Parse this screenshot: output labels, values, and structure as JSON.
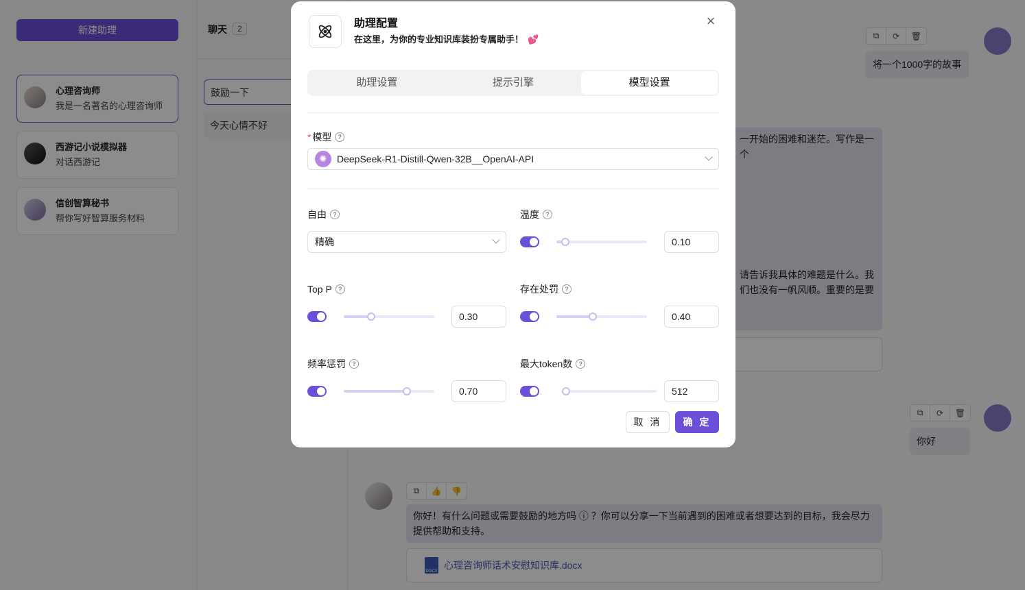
{
  "sidebar": {
    "new_button": "新建助理",
    "assistants": [
      {
        "title": "心理咨询师",
        "desc": "我是一名著名的心理咨询师"
      },
      {
        "title": "西游记小说模拟器",
        "desc": "对话西游记"
      },
      {
        "title": "信创智算秘书",
        "desc": "帮你写好智算服务材料"
      }
    ]
  },
  "topics": {
    "header": "聊天",
    "count": "2",
    "items": [
      "鼓励一下",
      "今天心情不好"
    ]
  },
  "chat": {
    "user_msg_1": "将一个1000字的故事",
    "ai_msg_1_line1": "一开始的困难和迷茫。写作是一个",
    "ai_msg_1_line2": "请告诉我具体的难题是什么。我",
    "ai_msg_1_line3": "们也没有一帆风顺。重要的是要",
    "user_msg_2": "你好",
    "ai_msg_2": "你好！有什么问题或需要鼓励的地方吗 ⓘ ？你可以分享一下当前遇到的困难或者想要达到的目标，我会尽力提供帮助和支持。",
    "file_name": "心理咨询师话术安慰知识库.docx",
    "file_badge": "DOCX"
  },
  "modal": {
    "title": "助理配置",
    "subtitle": "在这里，为你的专业知识库装扮专属助手！",
    "heart": "💕",
    "close": "×",
    "tabs": [
      "助理设置",
      "提示引擎",
      "模型设置"
    ],
    "model_label": "模型",
    "model_value": "DeepSeek-R1-Distill-Qwen-32B__OpenAI-API",
    "freedom_label": "自由",
    "freedom_value": "精确",
    "temperature_label": "温度",
    "temperature_value": "0.10",
    "top_p_label": "Top P",
    "top_p_value": "0.30",
    "presence_label": "存在处罚",
    "presence_value": "0.40",
    "frequency_label": "频率惩罚",
    "frequency_value": "0.70",
    "max_tokens_label": "最大token数",
    "max_tokens_value": "512",
    "cancel": "取 消",
    "ok": "确 定"
  },
  "colors": {
    "accent": "#6c4fd8"
  }
}
